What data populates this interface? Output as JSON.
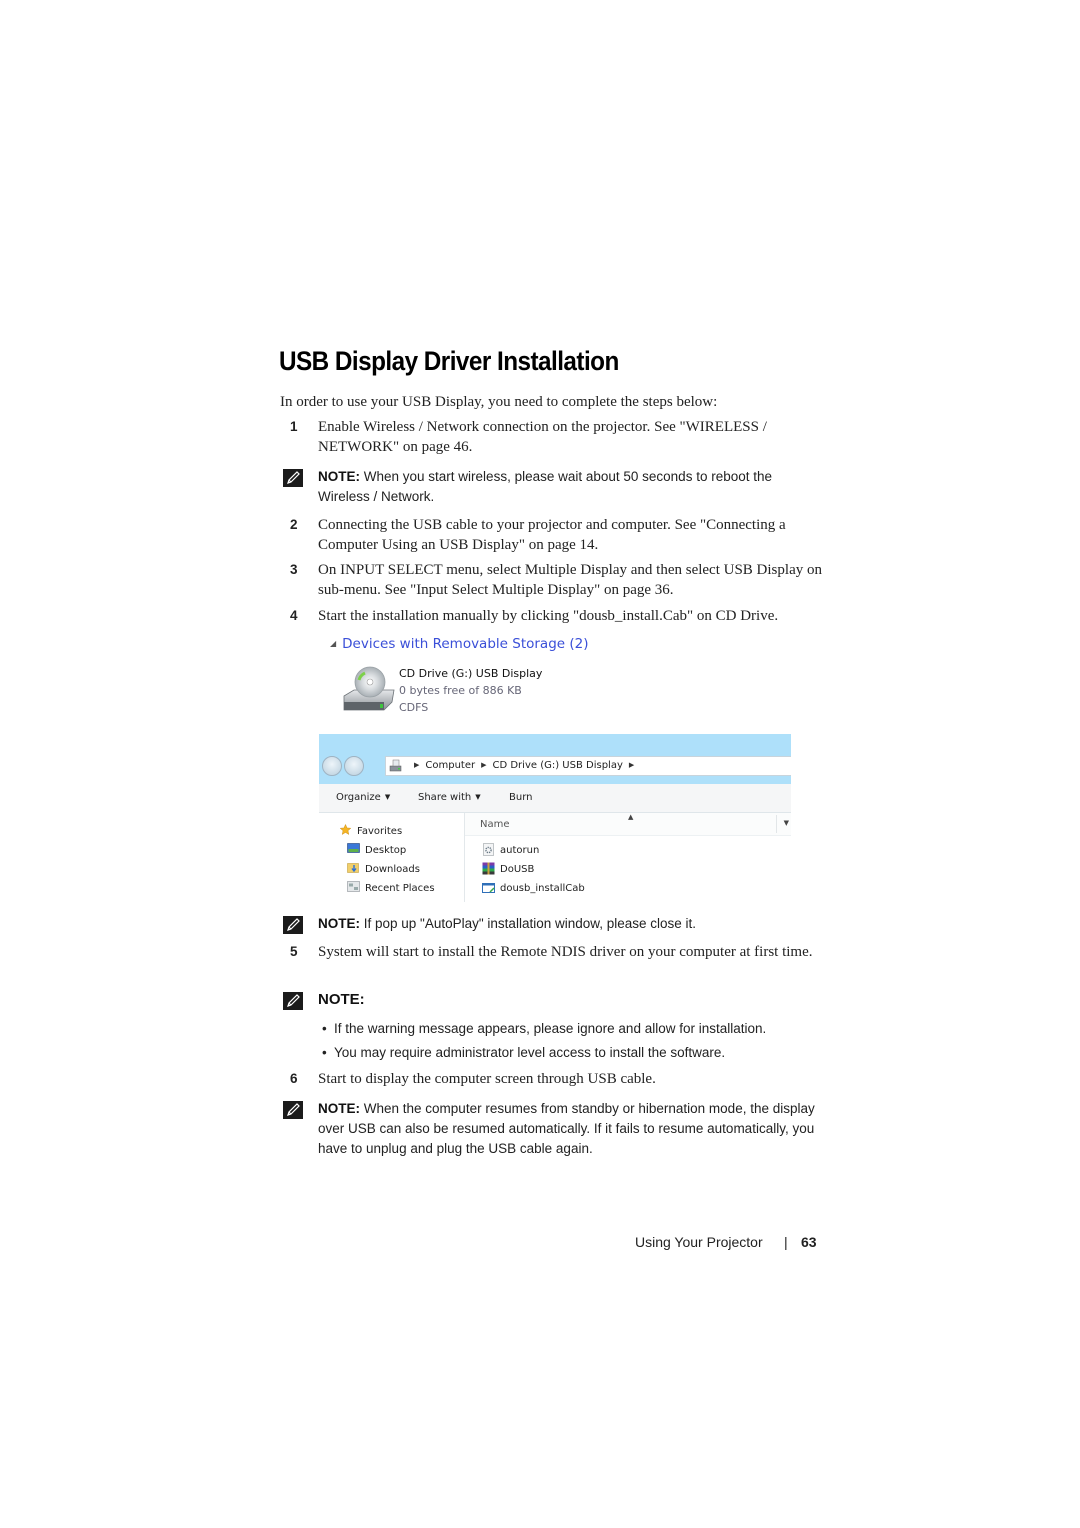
{
  "title": "USB Display Driver Installation",
  "intro": "In order to use your USB Display, you need to complete the steps below:",
  "steps": [
    {
      "num": "1",
      "text": "Enable Wireless / Network connection on the projector. See \"WIRELESS / NETWORK\" on page 46."
    },
    {
      "num": "2",
      "text": "Connecting the USB cable to your projector and computer. See \"Connecting a Computer Using an USB Display\" on page 14."
    },
    {
      "num": "3",
      "text": "On INPUT SELECT menu, select Multiple Display and then select USB Display on sub-menu. See \"Input Select Multiple Display\" on page 36."
    },
    {
      "num": "4",
      "text": "Start the installation manually by clicking \"dousb_install.Cab\" on CD Drive."
    },
    {
      "num": "5",
      "text": "System will start to install the Remote NDIS driver on your computer at first time."
    },
    {
      "num": "6",
      "text": "Start to display the computer screen through USB cable."
    }
  ],
  "notes": {
    "label": "NOTE:",
    "note1": "When you start wireless, please wait about 50 seconds to reboot the Wireless / Network.",
    "note2": "If pop up \"AutoPlay\" installation window, please close it.",
    "note3_bullets": [
      "If the warning message appears, please ignore and allow for installation.",
      "You may require administrator level access to install the software."
    ],
    "note4": "When the computer resumes from standby or hibernation mode, the display over USB can also be resumed automatically. If it fails to resume automatically, you have to unplug and plug the USB cable again."
  },
  "devices_panel": {
    "heading": "Devices with Removable Storage (2)",
    "drive_name": "CD Drive (G:) USB Display",
    "drive_space": "0 bytes free of 886 KB",
    "drive_fs": "CDFS"
  },
  "explorer": {
    "breadcrumb": [
      "Computer",
      "CD Drive (G:) USB Display"
    ],
    "toolbar": {
      "organize": "Organize",
      "share_with": "Share with",
      "burn": "Burn"
    },
    "nav_items": [
      "Favorites",
      "Desktop",
      "Downloads",
      "Recent Places"
    ],
    "column_name": "Name",
    "files": [
      "autorun",
      "DoUSB",
      "dousb_installCab"
    ]
  },
  "footer": {
    "section": "Using Your Projector",
    "separator": "|",
    "page": "63"
  }
}
